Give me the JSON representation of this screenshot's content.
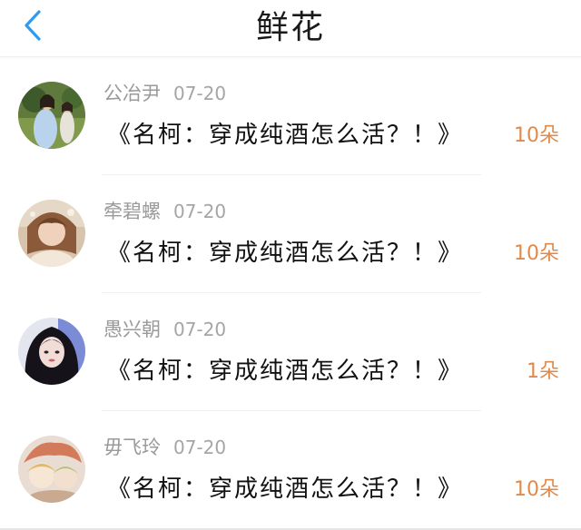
{
  "header": {
    "title": "鲜花",
    "back_icon": "chevron-left-icon",
    "accent_color": "#2f9bf0"
  },
  "colors": {
    "count_color": "#e08a4a",
    "username_color": "#9a9a9a"
  },
  "records": [
    {
      "username": "公冶尹",
      "date": "07-20",
      "book_title": "《名柯：穿成纯酒怎么活？！》",
      "count": "10朵",
      "avatar_icon": "avatar-photo"
    },
    {
      "username": "牵碧螺",
      "date": "07-20",
      "book_title": "《名柯：穿成纯酒怎么活？！》",
      "count": "10朵",
      "avatar_icon": "avatar-photo"
    },
    {
      "username": "愚兴朝",
      "date": "07-20",
      "book_title": "《名柯：穿成纯酒怎么活？！》",
      "count": "1朵",
      "avatar_icon": "avatar-photo"
    },
    {
      "username": "毋飞玲",
      "date": "07-20",
      "book_title": "《名柯：穿成纯酒怎么活？！》",
      "count": "10朵",
      "avatar_icon": "avatar-photo"
    }
  ]
}
